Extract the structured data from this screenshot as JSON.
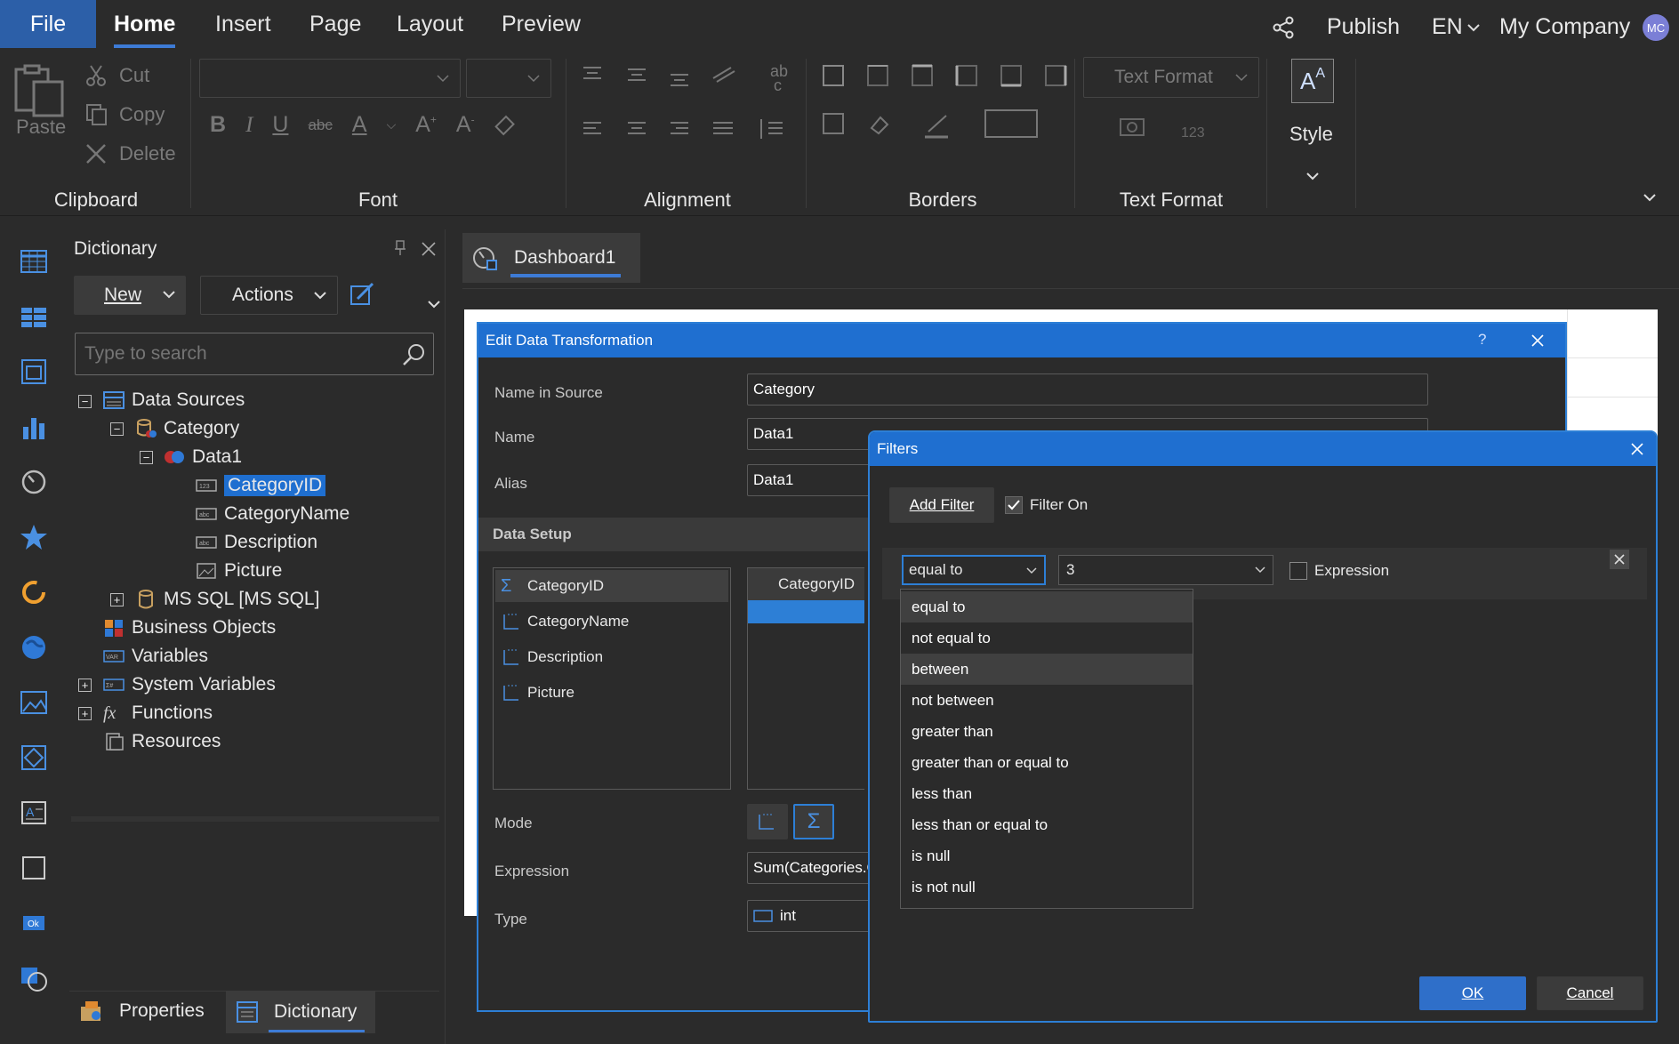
{
  "menu": {
    "file": "File",
    "tabs": [
      "Home",
      "Insert",
      "Page",
      "Layout",
      "Preview"
    ],
    "publish": "Publish",
    "lang": "EN",
    "company": "My Company",
    "avatar_initials": "MC"
  },
  "ribbon": {
    "clipboard": {
      "paste": "Paste",
      "cut": "Cut",
      "copy": "Copy",
      "delete": "Delete",
      "label": "Clipboard"
    },
    "font": {
      "label": "Font",
      "font_name": "",
      "font_size": ""
    },
    "alignment": {
      "label": "Alignment"
    },
    "borders": {
      "label": "Borders"
    },
    "text_format": {
      "label": "Text Format",
      "combo": "Text Format"
    },
    "style": {
      "label": "Style"
    }
  },
  "dictionary": {
    "title": "Dictionary",
    "new_label": "New",
    "actions_label": "Actions",
    "search_placeholder": "Type to search",
    "tree": {
      "data_sources": "Data Sources",
      "category": "Category",
      "data1": "Data1",
      "category_id": "CategoryID",
      "category_name": "CategoryName",
      "description": "Description",
      "picture": "Picture",
      "ms_sql": "MS SQL [MS SQL]",
      "business_objects": "Business Objects",
      "variables": "Variables",
      "system_variables": "System Variables",
      "functions": "Functions",
      "resources": "Resources"
    },
    "bottom_tabs": {
      "properties": "Properties",
      "dictionary": "Dictionary"
    }
  },
  "document_tab": "Dashboard1",
  "edit_dialog": {
    "title": "Edit Data Transformation",
    "help": "?",
    "name_in_source_label": "Name in Source",
    "name_in_source_value": "Category",
    "name_label": "Name",
    "name_value": "Data1",
    "alias_label": "Alias",
    "alias_value": "Data1",
    "data_setup": "Data Setup",
    "columns": [
      "CategoryID",
      "CategoryName",
      "Description",
      "Picture"
    ],
    "grid_header": "CategoryID",
    "mode_label": "Mode",
    "expression_label": "Expression",
    "expression_value": "Sum(Categories.C",
    "type_label": "Type",
    "type_value": "int"
  },
  "filters_dialog": {
    "title": "Filters",
    "add_filter": "Add Filter",
    "filter_on": "Filter On",
    "filter_on_checked": true,
    "condition": "equal to",
    "value": "3",
    "expression": "Expression",
    "expression_checked": false,
    "options": [
      "equal to",
      "not equal to",
      "between",
      "not between",
      "greater than",
      "greater than or equal to",
      "less than",
      "less than or equal to",
      "is null",
      "is not null"
    ],
    "ok": "OK",
    "cancel": "Cancel"
  },
  "colors": {
    "accent": "#1f6fd0",
    "file_tab": "#2c5fa8",
    "selected": "#1f6fd0",
    "background": "#2b2b2b"
  }
}
